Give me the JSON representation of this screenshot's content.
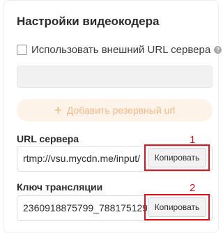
{
  "settings": {
    "title": "Настройки видеокодера",
    "external_url": {
      "checkbox_label": "Использовать внешний URL сервера",
      "help_icon": "question-circle-icon",
      "value": ""
    },
    "add_backup": {
      "icon": "plus-icon",
      "label": "Добавить резервный url"
    },
    "server_url": {
      "label": "URL сервера",
      "value": "rtmp://vsu.mycdn.me/input/",
      "copy_label": "Копировать"
    },
    "stream_key": {
      "label": "Ключ трансляции",
      "value": "2360918875799_788175129",
      "copy_label": "Копировать"
    }
  },
  "annotations": {
    "marker_1": "1",
    "marker_2": "2",
    "highlight_color": "#e0121c"
  },
  "colors": {
    "accent_light": "#fdf3e8",
    "accent_text": "#f2b98a"
  }
}
